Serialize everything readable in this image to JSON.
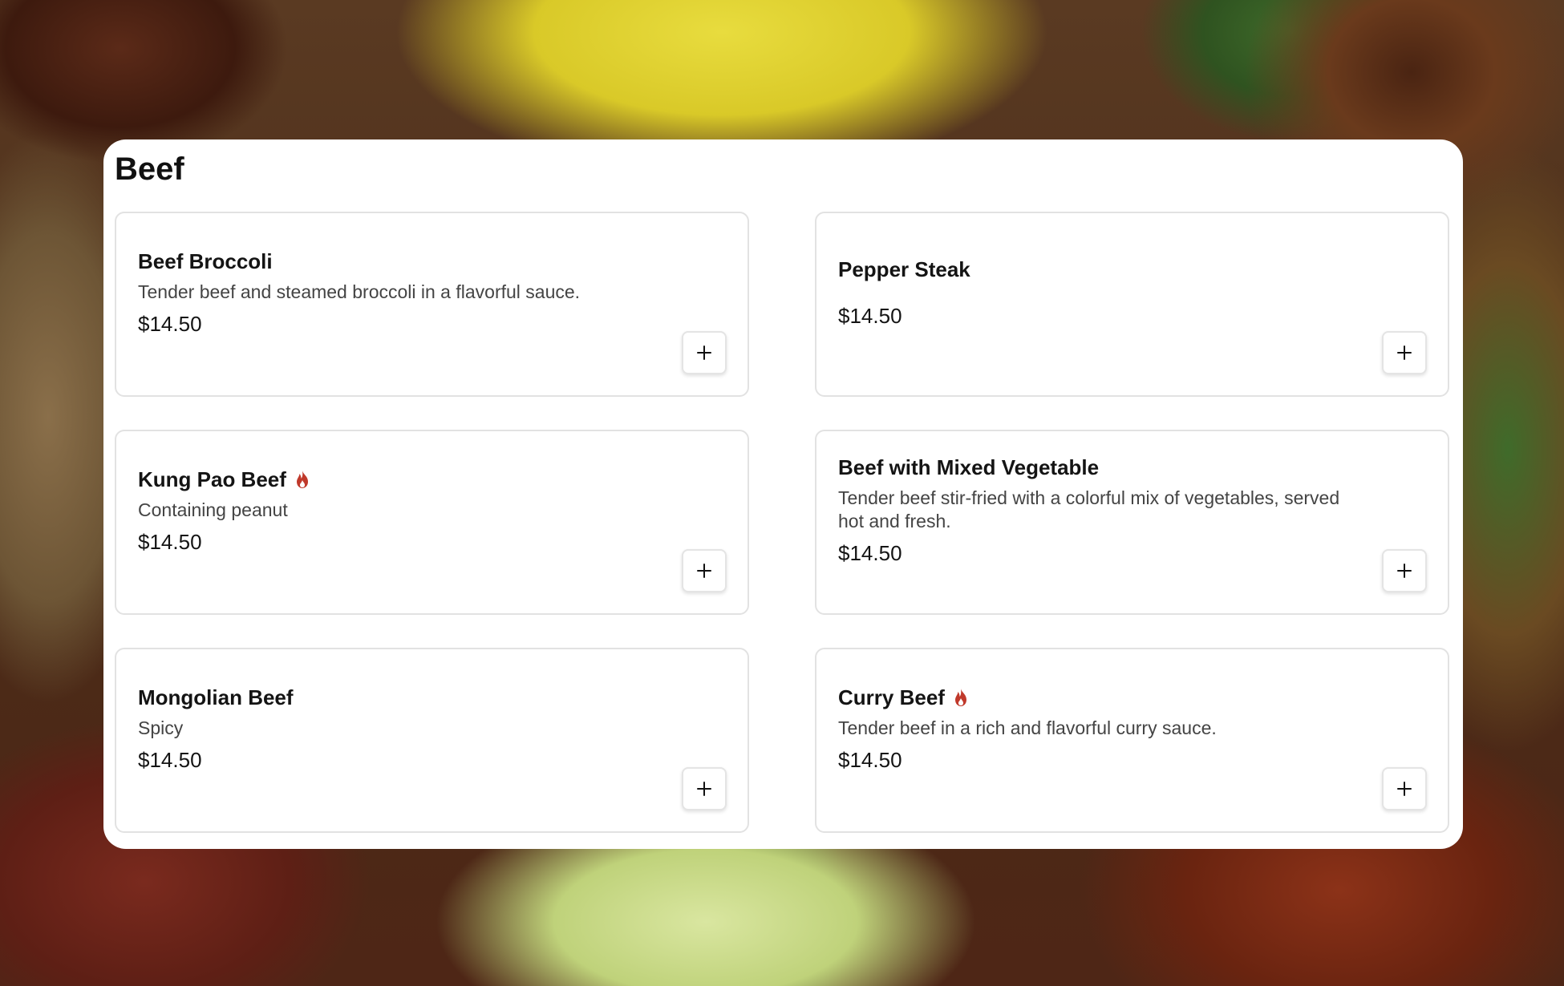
{
  "section": {
    "title": "Beef"
  },
  "colors": {
    "spicy_icon": "#c0392b",
    "panel_background": "#ffffff",
    "card_border": "#e2e2e2"
  },
  "items": [
    {
      "name": "Beef Broccoli",
      "description": "Tender beef and steamed broccoli in a flavorful sauce.",
      "price": "$14.50",
      "spicy": false,
      "add_icon": "plus-icon"
    },
    {
      "name": "Pepper Steak",
      "description": "",
      "price": "$14.50",
      "spicy": false,
      "add_icon": "plus-icon"
    },
    {
      "name": "Kung Pao Beef",
      "description": "Containing peanut",
      "price": "$14.50",
      "spicy": true,
      "add_icon": "plus-icon"
    },
    {
      "name": "Beef with Mixed Vegetable",
      "description": "Tender beef stir-fried with a colorful mix of vegetables, served hot and fresh.",
      "price": "$14.50",
      "spicy": false,
      "add_icon": "plus-icon"
    },
    {
      "name": "Mongolian Beef",
      "description": "Spicy",
      "price": "$14.50",
      "spicy": false,
      "add_icon": "plus-icon"
    },
    {
      "name": "Curry Beef",
      "description": "Tender beef in a rich and flavorful curry sauce.",
      "price": "$14.50",
      "spicy": true,
      "add_icon": "plus-icon"
    }
  ]
}
